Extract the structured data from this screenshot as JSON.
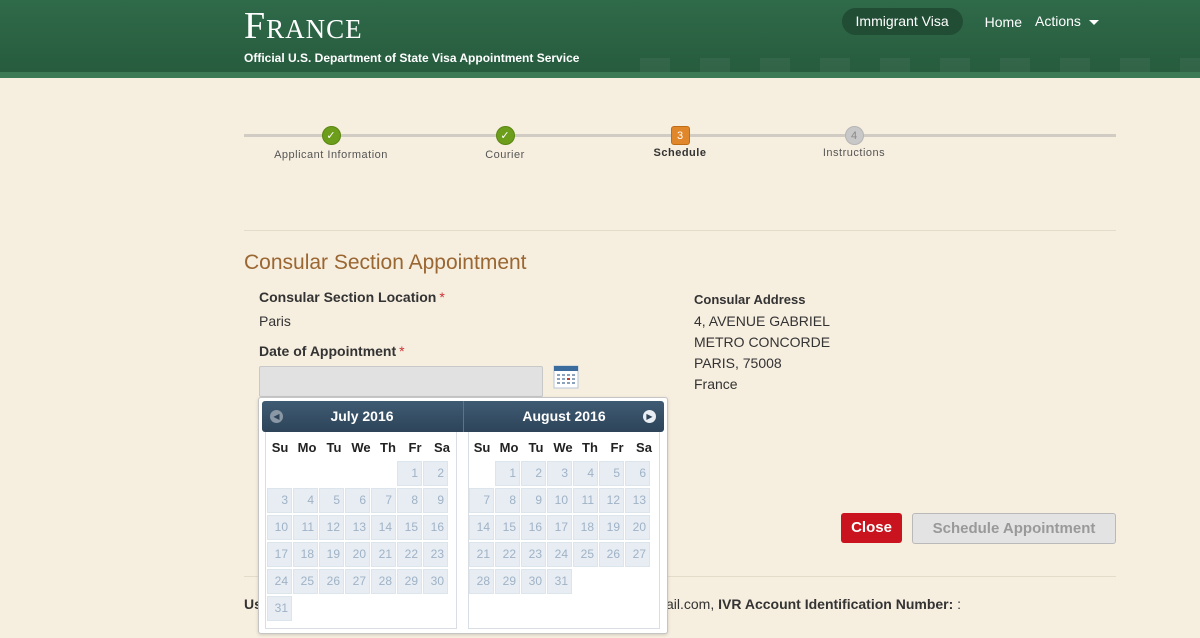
{
  "header": {
    "title": "France",
    "subtitle": "Official U.S. Department of State Visa Appointment Service",
    "nav": {
      "visa_type": "Immigrant Visa",
      "home": "Home",
      "actions": "Actions"
    }
  },
  "progress": {
    "steps": [
      {
        "label": "Applicant Information",
        "state": "done",
        "marker": "✓"
      },
      {
        "label": "Courier",
        "state": "done",
        "marker": "✓"
      },
      {
        "label": "Schedule",
        "state": "current",
        "marker": "3"
      },
      {
        "label": "Instructions",
        "state": "future",
        "marker": "4"
      }
    ]
  },
  "form": {
    "section_title": "Consular Section Appointment",
    "location_label": "Consular Section Location",
    "location_value": "Paris",
    "date_label": "Date of Appointment",
    "required_mark": "*",
    "date_value": ""
  },
  "address": {
    "title": "Consular Address",
    "lines": [
      "4, AVENUE GABRIEL",
      "METRO CONCORDE",
      "PARIS, 75008",
      "France"
    ]
  },
  "buttons": {
    "close": "Close",
    "schedule": "Schedule Appointment"
  },
  "footer": {
    "prefix": "Us",
    "email_suffix": "ail.com,",
    "ivr_label": "IVR Account Identification Number:",
    "ivr_value": ":"
  },
  "datepicker": {
    "weekdays": [
      "Su",
      "Mo",
      "Tu",
      "We",
      "Th",
      "Fr",
      "Sa"
    ],
    "months": [
      {
        "title": "July 2016",
        "first_weekday": 5,
        "days": 31
      },
      {
        "title": "August 2016",
        "first_weekday": 1,
        "days": 31
      }
    ],
    "icons": {
      "prev": "prev-arrow-icon",
      "next": "next-arrow-icon",
      "calendar": "calendar-icon"
    }
  }
}
